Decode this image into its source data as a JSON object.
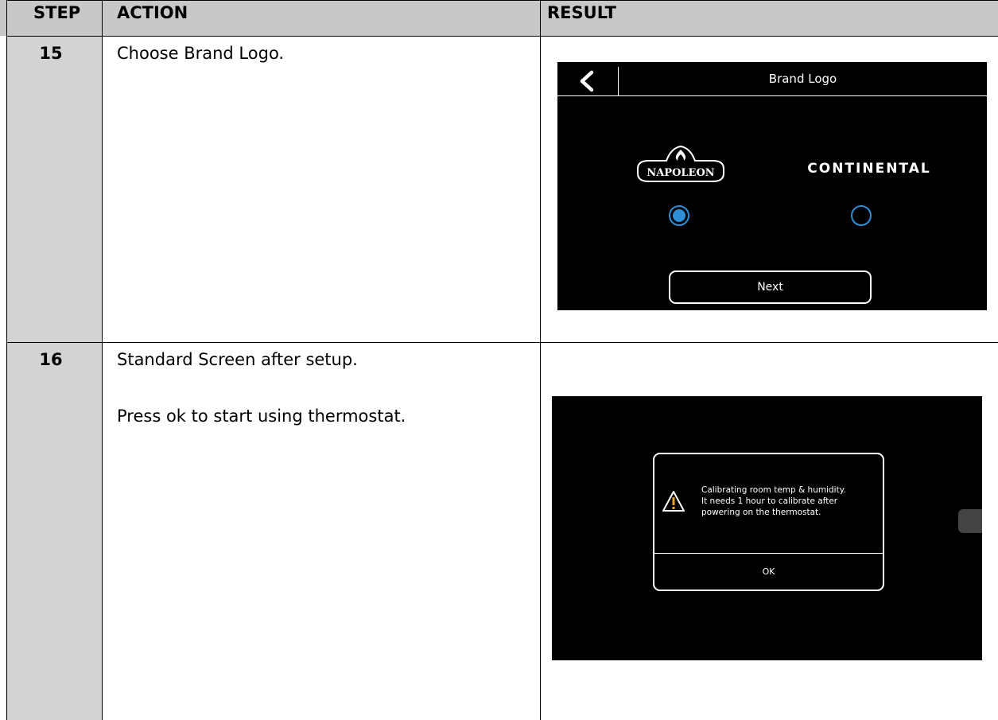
{
  "table": {
    "headers": [
      "STEP",
      "ACTION",
      "RESULT"
    ],
    "rows": [
      {
        "step": "15",
        "action": [
          "Choose Brand Logo."
        ],
        "result_screen": {
          "title": "Brand Logo",
          "brands": [
            {
              "name": "NAPOLEON",
              "selected": true
            },
            {
              "name": "CONTINENTAL",
              "selected": false
            }
          ],
          "next_label": "Next",
          "accent_color": "#2e8fd6",
          "back_icon": "chevron-left-icon"
        }
      },
      {
        "step": "16",
        "action": [
          "Standard Screen after setup.",
          "Press ok to start using thermostat."
        ],
        "result_screen": {
          "dialog_lines": [
            "Calibrating room temp & humidity.",
            "It needs 1 hour to calibrate after",
            "powering on the thermostat."
          ],
          "ok_label": "OK",
          "warning_icon": "warning-icon"
        }
      }
    ]
  }
}
